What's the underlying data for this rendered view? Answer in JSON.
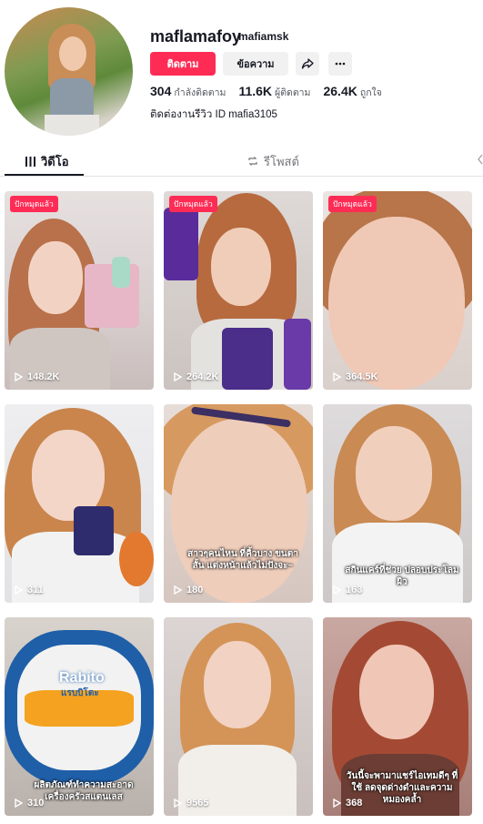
{
  "profile": {
    "username": "maflamafoy",
    "nickname": "mafiamsk",
    "follow_label": "ติดตาม",
    "message_label": "ข้อความ",
    "stats": [
      {
        "value": "304",
        "label": "กำลังติดตาม"
      },
      {
        "value": "11.6K",
        "label": "ผู้ติดตาม"
      },
      {
        "value": "26.4K",
        "label": "ถูกใจ"
      }
    ],
    "bio": "ติดต่องานรีวิว ID mafia3105"
  },
  "tabs": {
    "videos": "วิดีโอ",
    "reposts": "รีโพสต์"
  },
  "colors": {
    "accent": "#fe2c55",
    "text": "#161823",
    "muted_bg": "#f1f1f2"
  },
  "videos": [
    {
      "views": "148.2K",
      "badge": "ปักหมุดแล้ว",
      "caption": ""
    },
    {
      "views": "264.2K",
      "badge": "ปักหมุดแล้ว",
      "caption": ""
    },
    {
      "views": "364.5K",
      "badge": "ปักหมุดแล้ว",
      "caption": ""
    },
    {
      "views": "311",
      "badge": "",
      "caption": ""
    },
    {
      "views": "180",
      "badge": "",
      "caption": "สาวๆคนไหน ที่คิ้วบาง ขนตาสั้น แต่งหน้าแล้วไม่ปังจะ~"
    },
    {
      "views": "163",
      "badge": "",
      "caption": "สกินแคร์ที่ช่วย ปลอบประโลมผิว"
    },
    {
      "views": "310",
      "badge": "",
      "caption": "ผลิตภัณฑ์ทำความสะอาด เครื่องครัวสแตนเลส"
    },
    {
      "views": "9565",
      "badge": "",
      "caption": ""
    },
    {
      "views": "368",
      "badge": "",
      "caption": "วันนี้จะพามาแชร์ไอเทมดีๆ ที่ใช้ ลดจุดด่างดำและความหมองคล้ำ"
    }
  ],
  "product_label": {
    "brand": "Rabito",
    "brand_sub": "แรบบิโตะ"
  }
}
